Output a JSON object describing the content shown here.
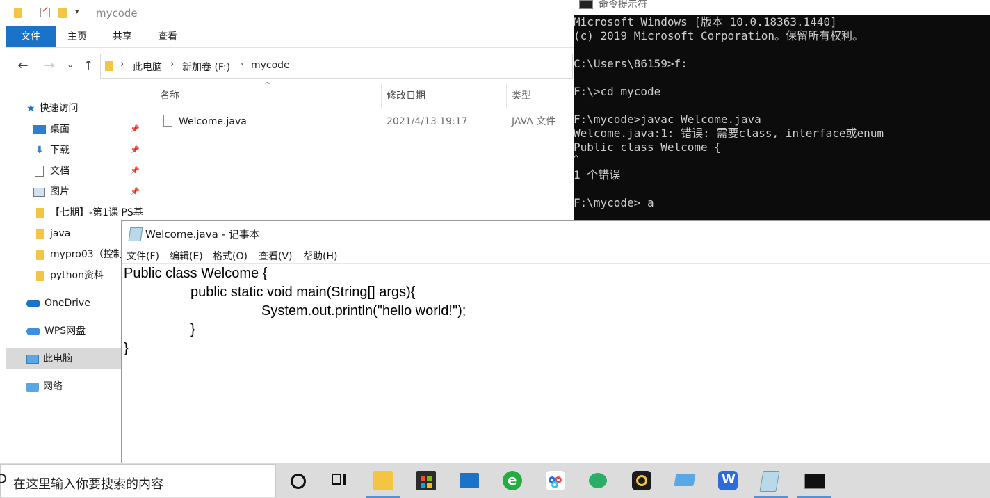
{
  "explorer": {
    "title": "mycode",
    "ribbon_tabs": [
      "文件",
      "主页",
      "共享",
      "查看"
    ],
    "breadcrumb": [
      "此电脑",
      "新加卷 (F:)",
      "mycode"
    ],
    "nav": {
      "quick_access": "快速访问",
      "pinned": [
        "桌面",
        "下载",
        "文档",
        "图片"
      ],
      "folders": [
        "【七期】-第1课 PS基",
        "java",
        "mypro03（控制",
        "python资料"
      ],
      "onedrive": "OneDrive",
      "wps": "WPS网盘",
      "this_pc": "此电脑",
      "network": "网络"
    },
    "columns": [
      "名称",
      "修改日期",
      "类型"
    ],
    "files": [
      {
        "name": "Welcome.java",
        "modified": "2021/4/13 19:17",
        "type": "JAVA 文件"
      }
    ]
  },
  "cmd": {
    "title": "命令提示符",
    "lines": [
      "Microsoft Windows [版本 10.0.18363.1440]",
      "(c) 2019 Microsoft Corporation。保留所有权利。",
      "",
      "C:\\Users\\86159>f:",
      "",
      "F:\\>cd mycode",
      "",
      "F:\\mycode>javac Welcome.java",
      "Welcome.java:1: 错误: 需要class, interface或enum",
      "Public class Welcome {",
      "^",
      "1 个错误",
      "",
      "F:\\mycode> a"
    ]
  },
  "notepad": {
    "title": "Welcome.java - 记事本",
    "menus": [
      "文件(F)",
      "编辑(E)",
      "格式(O)",
      "查看(V)",
      "帮助(H)"
    ],
    "code": [
      "Public class Welcome {",
      "public static void main(String[] args){",
      "System.out.println(\"hello world!\");",
      "}",
      "}"
    ]
  },
  "taskbar": {
    "search_placeholder": "在这里输入你要搜索的内容"
  }
}
